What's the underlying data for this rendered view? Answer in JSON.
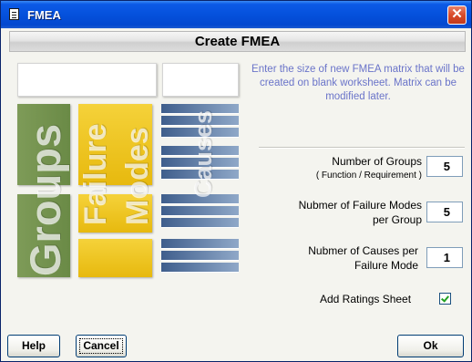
{
  "window": {
    "title": "FMEA",
    "close_glyph": "✕"
  },
  "header": {
    "title": "Create FMEA"
  },
  "graphic": {
    "groups_text": "Groups",
    "failure_text": "Failure",
    "modes_text": "Modes",
    "causes_text": "Causes",
    "colors": {
      "groups": "#6f8f4b",
      "failure_modes": "#f0c823",
      "causes": "#4a6896"
    }
  },
  "info": {
    "text": "Enter the size of new FMEA matrix that will be created on blank worksheet. Matrix can be modified later."
  },
  "fields": {
    "groups": {
      "label": "Number of Groups",
      "sublabel": "( Function / Requirement )",
      "value": "5"
    },
    "failure_modes": {
      "label_line1": "Nubmer of Failure Modes",
      "label_line2": "per Group",
      "value": "5"
    },
    "causes": {
      "label_line1": "Nubmer of Causes per",
      "label_line2": "Failure Mode",
      "value": "1"
    }
  },
  "ratings": {
    "label": "Add Ratings Sheet",
    "checked": true
  },
  "buttons": {
    "help": "Help",
    "cancel": "Cancel",
    "ok": "Ok"
  }
}
